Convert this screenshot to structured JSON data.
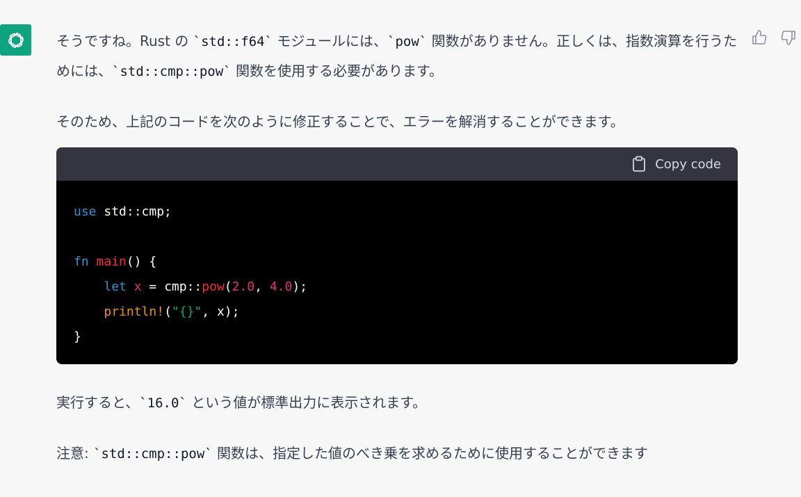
{
  "message": {
    "p1_pre": "そうですね。Rust の ",
    "p1_code1": "`std::f64`",
    "p1_mid1": " モジュールには、",
    "p1_code2": "`pow`",
    "p1_mid2": " 関数がありません。正しくは、指数演算を行うた",
    "p1_line2_pre": "めには、",
    "p1_code3": "`std::cmp::pow`",
    "p1_line2_post": " 関数を使用する必要があります。",
    "p2": "そのため、上記のコードを次のように修正することで、エラーを解消することができます。",
    "p3_pre": "実行すると、",
    "p3_code": "`16.0`",
    "p3_post": " という値が標準出力に表示されます。",
    "p4_pre": "注意: ",
    "p4_code": "`std::cmp::pow`",
    "p4_post": " 関数は、指定した値のべき乗を求めるために使用することができます"
  },
  "codeblock": {
    "copy_label": "Copy code",
    "lines": {
      "l1_kw": "use",
      "l1_rest": " std::cmp;",
      "l3_kw": "fn",
      "l3_fn": "main",
      "l3_rest": "() {",
      "l4_kw": "let",
      "l4_var": "x",
      "l4_eq": " = cmp::",
      "l4_fn": "pow",
      "l4_open": "(",
      "l4_n1": "2.0",
      "l4_comma": ", ",
      "l4_n2": "4.0",
      "l4_close": ");",
      "l5_mac": "println!",
      "l5_open": "(",
      "l5_str": "\"{}\"",
      "l5_rest": ", x);",
      "l6": "}"
    }
  },
  "colors": {
    "avatar_bg": "#10a37f",
    "keyword": "#2e95d3",
    "function": "#f22c3d",
    "number": "#df3079",
    "macro": "#e9950c",
    "string": "#00a67d"
  },
  "icons": [
    "openai-logo-icon",
    "thumbs-up-icon",
    "thumbs-down-icon",
    "clipboard-icon"
  ]
}
